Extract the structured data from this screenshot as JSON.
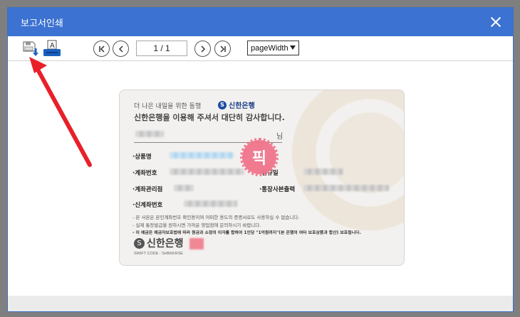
{
  "dialog": {
    "title": "보고서인쇄",
    "close_icon": "close-icon"
  },
  "toolbar": {
    "save_icon": "save-download-icon",
    "print_icon": "print-icon",
    "first_icon": "first-page-icon",
    "prev_icon": "prev-page-icon",
    "next_icon": "next-page-icon",
    "last_icon": "last-page-icon",
    "page_indicator": "1 / 1",
    "zoom_selected": "pageWidth"
  },
  "report": {
    "tagline": "더 나은 내일을 위한 동행",
    "bank_name": "신한은행",
    "thanks": "신한은행을 이용해 주셔서 대단히 감사합니다.",
    "honorific": "님",
    "stamp_text": "픽",
    "labels": {
      "product": "·상품명",
      "account_no": "·계좌번호",
      "new_date": "·신규일",
      "branch": "·계좌관리점",
      "passbook_print": "·통장사본출력",
      "new_account_no": "·신계좌번호"
    },
    "notes": [
      "- 본 사본은 본인계좌번호 확인용이며 어떠한 용도의 증명서로도 사용하실 수 없습니다.",
      "- 실제 통장발급을 원하시면 가까운 영업점에 문의하시기 바랍니다.",
      "- 이 예금은 예금자보호법에 따라 원금과 소정의 이자를 합하여 1인당 \"1억원까지\"(본 은행의 여타 보호상품과 합산) 보호됩니다."
    ],
    "footer_logo": "신한은행",
    "swift": "SWIFT CODE : SHBKKRSE"
  },
  "colors": {
    "titlebar": "#3c72d1",
    "arrow": "#e8202a",
    "stamp": "#f0728a"
  }
}
